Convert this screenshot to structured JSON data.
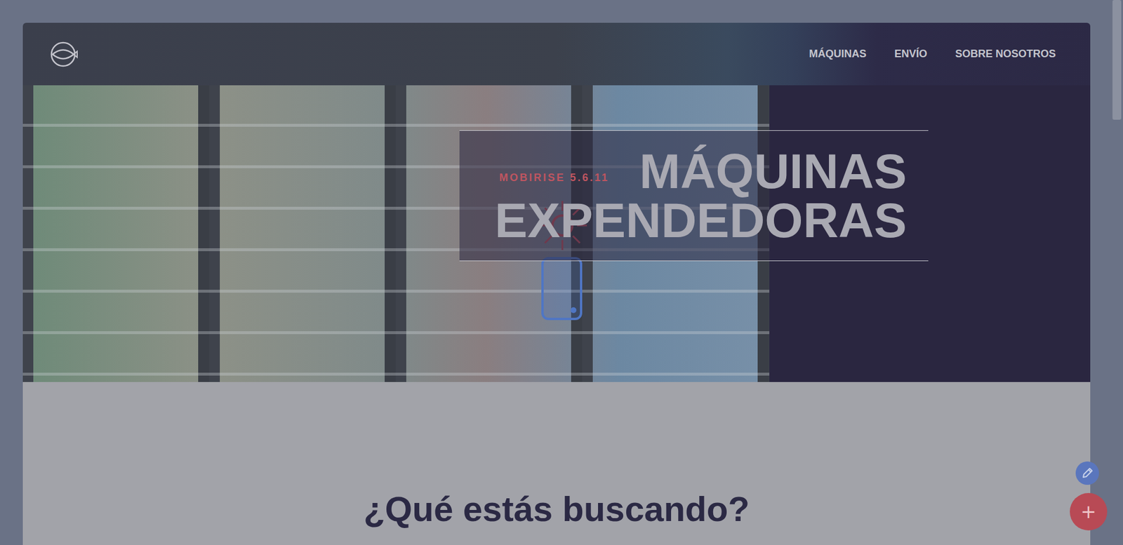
{
  "header": {
    "nav": [
      {
        "label": "MÁQUINAS"
      },
      {
        "label": "ENVÍO"
      },
      {
        "label": "SOBRE NOSOTROS"
      }
    ]
  },
  "hero": {
    "badge": "MOBIRISE 5.6.11",
    "title_lines": [
      "MÁQUINAS",
      "EXPENDEDORAS"
    ]
  },
  "section": {
    "heading": "¿Qué estás buscando?"
  },
  "floating_buttons": [
    {
      "kind": "edit",
      "label": ""
    },
    {
      "kind": "add",
      "label": "+"
    }
  ],
  "scrollbar": {
    "position": 0,
    "visible_share": 0.22
  }
}
